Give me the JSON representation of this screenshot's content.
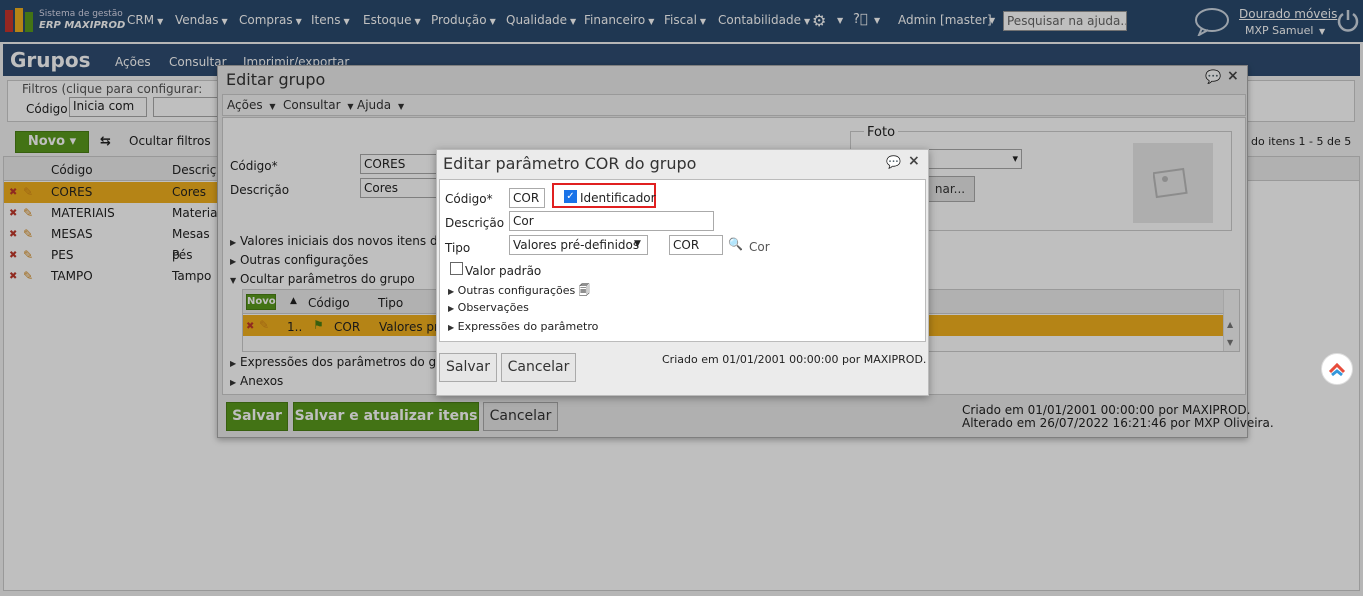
{
  "nav": {
    "brand_line1": "Sistema de gestão",
    "brand_line2": "ERP MAXIPROD",
    "items": [
      "CRM",
      "Vendas",
      "Compras",
      "Itens",
      "Estoque",
      "Produção",
      "Qualidade",
      "Financeiro",
      "Fiscal",
      "Contabilidade"
    ],
    "admin": "Admin [master]",
    "search_placeholder": "Pesquisar na ajuda...",
    "company": "Dourado móveis",
    "user": "MXP Samuel"
  },
  "page": {
    "title": "Grupos",
    "menu": [
      "Ações",
      "Consultar",
      "Imprimir/exportar"
    ],
    "filters_label": "Filtros (clique para configurar:",
    "filter_field": "Código",
    "filter_op": "Inicia com",
    "novo": "Novo",
    "hide_filters": "Ocultar filtros",
    "range": "do itens 1 - 5 de 5",
    "columns": [
      "Código",
      "Descriç"
    ],
    "rows": [
      {
        "code": "CORES",
        "desc": "Cores"
      },
      {
        "code": "MATERIAIS",
        "desc": "Materiais"
      },
      {
        "code": "MESAS",
        "desc": "Mesas p"
      },
      {
        "code": "PES",
        "desc": "Pés"
      },
      {
        "code": "TAMPO",
        "desc": "Tampo"
      }
    ]
  },
  "edit_group": {
    "title": "Editar grupo",
    "menu": [
      "Ações",
      "Consultar",
      "Ajuda"
    ],
    "codigo_label": "Código*",
    "codigo_value": "CORES",
    "descricao_label": "Descrição",
    "descricao_value": "Cores",
    "foto_label": "Foto",
    "foto_button": "nar...",
    "sections": [
      "Valores iniciais dos novos itens deste",
      "Outras configurações",
      "Ocultar parâmetros do grupo"
    ],
    "param_cols": [
      "Novo",
      "Código",
      "Tipo"
    ],
    "param_row": {
      "num": "1..",
      "code": "COR",
      "tipo": "Valores pr"
    },
    "sections2": [
      "Expressões dos parâmetros do grupo",
      "Anexos"
    ],
    "save": "Salvar",
    "save_update": "Salvar e atualizar itens",
    "cancel": "Cancelar",
    "created": "Criado em 01/01/2001 00:00:00 por MAXIPROD.",
    "altered": "Alterado em 26/07/2022 16:21:46 por MXP Oliveira."
  },
  "param_dialog": {
    "title": "Editar parâmetro COR do grupo",
    "codigo_label": "Código*",
    "codigo_value": "COR",
    "identificador_label": "Identificador",
    "identificador_checked": true,
    "descricao_label": "Descrição",
    "descricao_value": "Cor",
    "tipo_label": "Tipo",
    "tipo_value": "Valores pré-definidos",
    "lookup_value": "COR",
    "lookup_text": "Cor",
    "valor_padrao_label": "Valor padrão",
    "sections": [
      "Outras configurações",
      "Observações",
      "Expressões do parâmetro"
    ],
    "save": "Salvar",
    "cancel": "Cancelar",
    "created": "Criado em 01/01/2001 00:00:00 por MAXIPROD."
  }
}
